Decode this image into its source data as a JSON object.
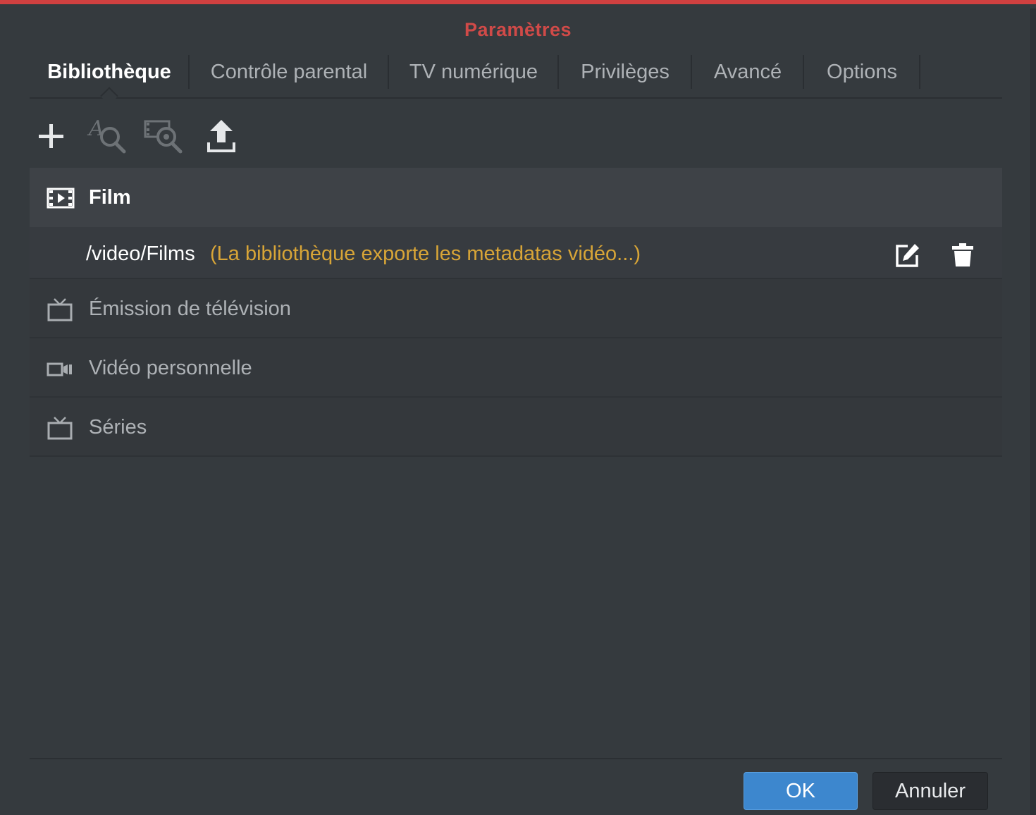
{
  "dialog": {
    "title": "Paramètres",
    "accent_color": "#d04040"
  },
  "tabs": [
    {
      "label": "Bibliothèque",
      "active": true
    },
    {
      "label": "Contrôle parental",
      "active": false
    },
    {
      "label": "TV numérique",
      "active": false
    },
    {
      "label": "Privilèges",
      "active": false
    },
    {
      "label": "Avancé",
      "active": false
    },
    {
      "label": "Options",
      "active": false
    }
  ],
  "toolbar": {
    "buttons": [
      {
        "icon": "plus-icon",
        "enabled": true
      },
      {
        "icon": "text-search-icon",
        "enabled": false
      },
      {
        "icon": "video-search-icon",
        "enabled": false
      },
      {
        "icon": "upload-icon",
        "enabled": true
      }
    ]
  },
  "library": {
    "film": {
      "label": "Film",
      "icon": "film-icon",
      "path": "/video/Films",
      "status": "(La bibliothèque exporte les metadatas vidéo...)",
      "status_color": "#d8a537"
    },
    "categories": [
      {
        "label": "Émission de télévision",
        "icon": "tv-icon"
      },
      {
        "label": "Vidéo personnelle",
        "icon": "camcorder-icon"
      },
      {
        "label": "Séries",
        "icon": "tv-icon"
      }
    ]
  },
  "footer": {
    "ok_label": "OK",
    "cancel_label": "Annuler",
    "ok_color": "#3d87ce"
  }
}
